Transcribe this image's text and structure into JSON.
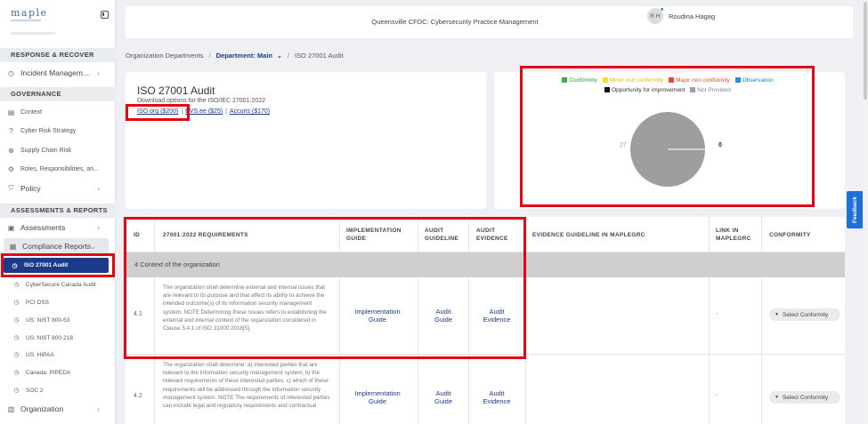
{
  "sidebar": {
    "logo": "maple",
    "sections": {
      "response": "RESPONSE & RECOVER",
      "governance": "GOVERNANCE",
      "assessments": "ASSESSMENTS & REPORTS"
    },
    "items": {
      "incident": "Incident Managem...",
      "context": "Context",
      "cyber_risk": "Cyber Risk Strategy",
      "supply_chain": "Supply Chain Risk",
      "roles": "Roles, Responsibilities, an...",
      "policy": "Policy",
      "assessments": "Assessments",
      "compliance": "Compliance Reports",
      "iso": "ISO 27001 Audit",
      "cybersecure": "CyberSecure Canada Audit",
      "pci": "PCI DSS",
      "nist53": "US: NIST 800-53",
      "nist218": "US: NIST 800-218",
      "hipaa": "US: HIPAA",
      "pipeda": "Canada: PIPEDA",
      "soc2": "SOC 2",
      "organization": "Organization"
    }
  },
  "header": {
    "title": "Queensville CFDC: Cybersecurity Practice Management",
    "avatar_initials": "R H",
    "user_name": "Roudina Hagag"
  },
  "breadcrumb": {
    "root": "Organization Departments",
    "department": "Department: Main",
    "current": "ISO 27001 Audit"
  },
  "audit": {
    "title": "ISO 27001 Audit",
    "download_text": "Download options for the ISO/IEC 27001:2022",
    "links": [
      "ISO.org ($200)",
      "EVS.ee ($25)",
      "Accuris ($170)"
    ]
  },
  "chart_data": {
    "type": "pie",
    "legend": [
      {
        "name": "Conformity",
        "color": "#3cb043"
      },
      {
        "name": "Minor non conformity",
        "color": "#f2e230"
      },
      {
        "name": "Major non conformity",
        "color": "#e8473a"
      },
      {
        "name": "Observation",
        "color": "#2a8fe0"
      },
      {
        "name": "Opportunity for improvement",
        "color": "#111111"
      },
      {
        "name": "Not Provided",
        "color": "#9e9e9e"
      }
    ],
    "values": [
      0,
      0,
      0,
      0,
      0,
      27
    ],
    "labels": {
      "left": "27",
      "right": "0"
    },
    "legend_position": "top"
  },
  "table": {
    "headers": {
      "id": "ID",
      "req": "27001:2022 REQUIREMENTS",
      "impl1": "IMPLEMENTATION",
      "impl2": "GUIDE",
      "guide1": "AUDIT",
      "guide2": "GUIDELINE",
      "evid1": "AUDIT",
      "evid2": "EVIDENCE",
      "evguide": "EVIDENCE GUIDELINE IN MAPLEGRC",
      "link1": "LINK IN",
      "link2": "MAPLEGRC",
      "conf": "CONFORMITY"
    },
    "group": "4 Context of the organization",
    "rows": [
      {
        "id": "4.1",
        "text": "The organization shall determine external and internal issues that are relevant to its purpose and that affect its ability to achieve the intended outcome(s) of its information security management system. NOTE Determining these issues refers to establishing the external and internal context of the organization considered in Clause 5.4.1 of ISO 31000:2018[5].",
        "impl_1": "Implementation",
        "impl_2": "Guide",
        "guide_1": "Audit",
        "guide_2": "Guide",
        "evid_1": "Audit",
        "evid_2": "Evidence",
        "link": "-",
        "select": "Select Conformity"
      },
      {
        "id": "4.2",
        "text": "The organization shall determine: a) interested parties that are relevant to the information security management system; b) the relevant requirements of these interested parties; c) which of these requirements will be addressed through the information security management system. NOTE The requirements of interested parties can include legal and regulatory requirements and contractual",
        "impl_1": "Implementation",
        "impl_2": "Guide",
        "guide_1": "Audit",
        "guide_2": "Guide",
        "evid_1": "Audit",
        "evid_2": "Evidence",
        "link": "-",
        "select": "Select Conformity"
      }
    ]
  },
  "feedback": "Feedback"
}
